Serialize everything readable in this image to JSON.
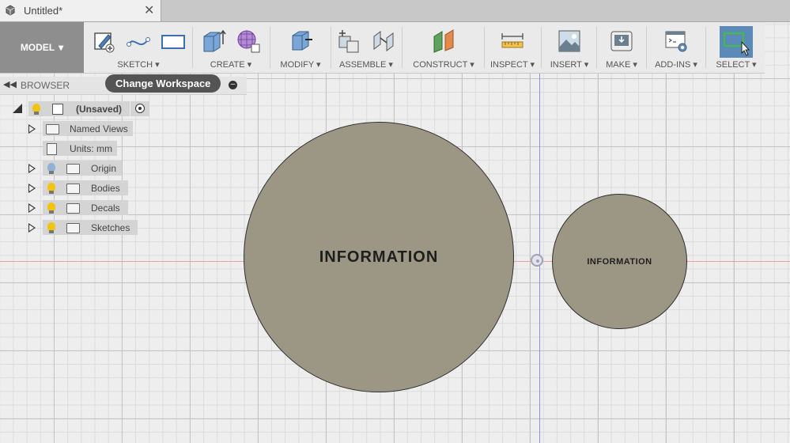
{
  "tab": {
    "title": "Untitled*",
    "close": "✕"
  },
  "toolbar": {
    "workspace": "MODEL",
    "groups": [
      {
        "label": "SKETCH"
      },
      {
        "label": "CREATE"
      },
      {
        "label": "MODIFY"
      },
      {
        "label": "ASSEMBLE"
      },
      {
        "label": "CONSTRUCT"
      },
      {
        "label": "INSPECT"
      },
      {
        "label": "INSERT"
      },
      {
        "label": "MAKE"
      },
      {
        "label": "ADD-INS"
      },
      {
        "label": "SELECT"
      }
    ]
  },
  "tooltip": "Change Workspace",
  "browser": {
    "title": "BROWSER",
    "root": "(Unsaved)",
    "nodes": [
      {
        "label": "Named Views"
      },
      {
        "label": "Units: mm"
      },
      {
        "label": "Origin"
      },
      {
        "label": "Bodies"
      },
      {
        "label": "Decals"
      },
      {
        "label": "Sketches"
      }
    ]
  },
  "canvas": {
    "large_disk_text": "INFORMATION",
    "small_disk_text": "INFORMATION"
  },
  "colors": {
    "select_active": "#5b8ab8",
    "disk_fill": "#9c9784",
    "bulb_on": "#f2c40d",
    "bulb_off": "#8fb2d6"
  }
}
